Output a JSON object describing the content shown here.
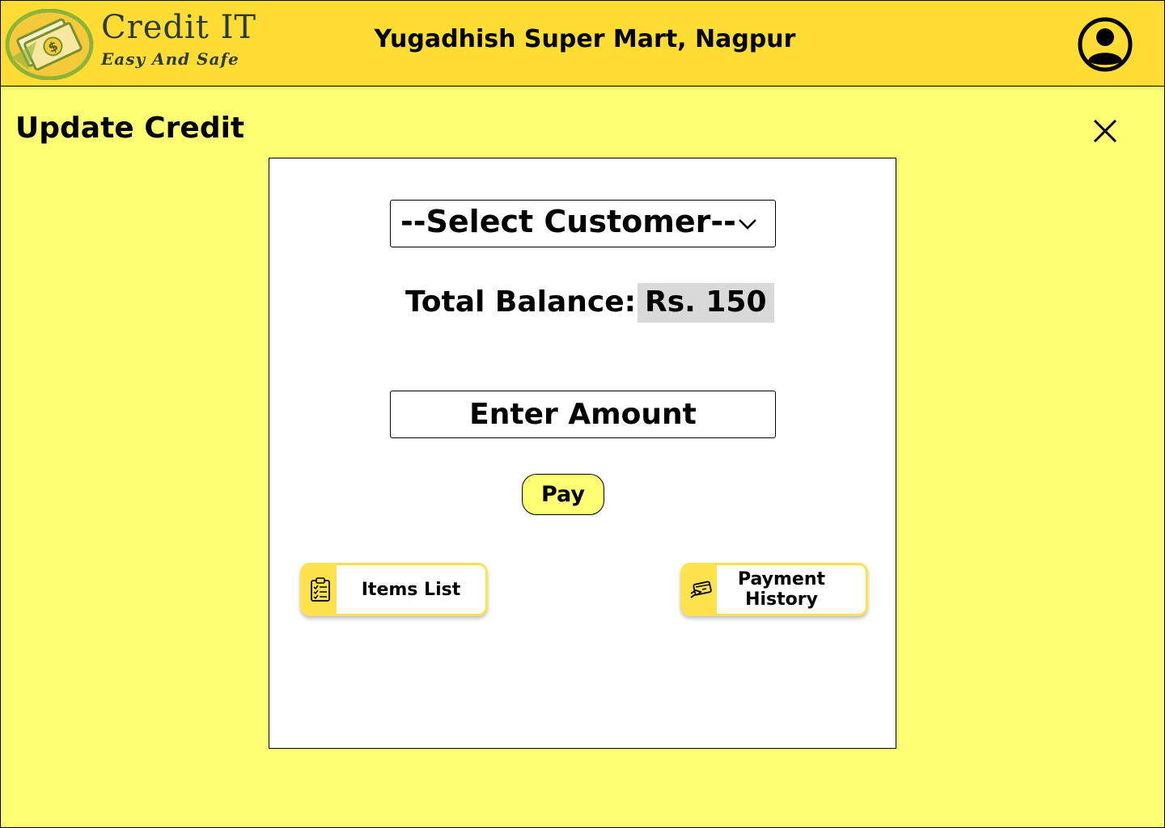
{
  "header": {
    "logo_title": "Credit IT",
    "logo_tagline": "Easy And Safe",
    "store_name": "Yugadhish Super Mart, Nagpur",
    "profile_icon": "user-circle-icon"
  },
  "page": {
    "title": "Update Credit",
    "close_icon": "close-icon"
  },
  "form": {
    "customer_select": {
      "selected": "--Select Customer--",
      "icon": "chevron-down-icon"
    },
    "balance_label": "Total Balance:",
    "balance_value": "Rs. 150",
    "amount": {
      "value": "",
      "placeholder": "Enter Amount"
    },
    "pay_label": "Pay"
  },
  "actions": {
    "items_list": {
      "label": "Items List",
      "icon": "clipboard-list-icon"
    },
    "payment_history": {
      "label": "Payment History",
      "icon": "card-payment-icon"
    }
  },
  "colors": {
    "header_bg": "#ffdd33",
    "page_bg": "#ffff73",
    "accent": "#ffe24d",
    "balance_bg": "#d9d9d9"
  }
}
